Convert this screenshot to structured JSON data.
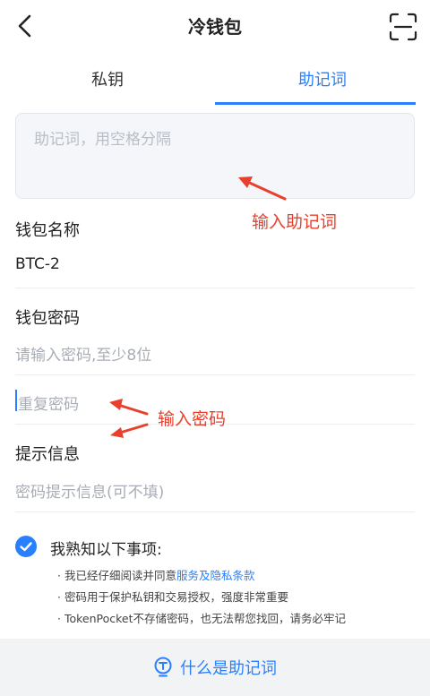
{
  "header": {
    "title": "冷钱包",
    "back_icon": "chevron-left-icon",
    "scan_icon": "scan-icon"
  },
  "tabs": [
    {
      "label": "私钥",
      "active": false
    },
    {
      "label": "助记词",
      "active": true
    }
  ],
  "mnemonic": {
    "placeholder": "助记词，用空格分隔"
  },
  "annotations": {
    "mnemonic_hint": "输入助记词",
    "password_hint": "输入密码"
  },
  "wallet_name": {
    "label": "钱包名称",
    "value": "BTC-2"
  },
  "wallet_password": {
    "label": "钱包密码",
    "placeholder": "请输入密码,至少8位",
    "repeat_placeholder": "重复密码"
  },
  "hint_info": {
    "label": "提示信息",
    "placeholder": "密码提示信息(可不填)"
  },
  "agreement": {
    "checked": true,
    "title": "我熟知以下事项:",
    "note1_prefix": "· 我已经仔细阅读并同意",
    "note1_link": "服务及隐私条款",
    "note2": "· 密码用于保护私钥和交易授权，强度非常重要",
    "note3": "· TokenPocket不存储密码，也无法帮您找回，请务必牢记"
  },
  "footer": {
    "label": "什么是助记词",
    "icon": "bulb-icon"
  },
  "colors": {
    "accent": "#2980fe",
    "annotation": "#e8402c"
  }
}
